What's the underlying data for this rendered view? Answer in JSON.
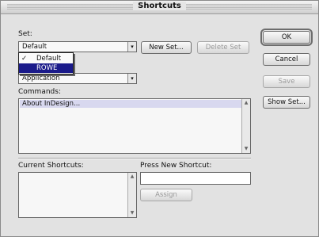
{
  "window": {
    "title": "Shortcuts"
  },
  "set": {
    "label": "Set:",
    "selected": "Default",
    "menu": {
      "items": [
        {
          "check": "✓",
          "label": "Default"
        },
        {
          "check": "",
          "label": "ROWE"
        }
      ]
    },
    "new_set_label": "New Set...",
    "delete_set_label": "Delete Set"
  },
  "context": {
    "selected": "Application"
  },
  "commands": {
    "label": "Commands:",
    "items": [
      "About InDesign..."
    ]
  },
  "current_shortcuts": {
    "label": "Current Shortcuts:"
  },
  "press_new": {
    "label": "Press New Shortcut:",
    "value": "",
    "assign_label": "Assign"
  },
  "side_buttons": {
    "ok": "OK",
    "cancel": "Cancel",
    "save": "Save",
    "show_set": "Show Set..."
  },
  "icons": {
    "dropdown": "▾",
    "scroll_up": "▲",
    "scroll_down": "▼"
  }
}
